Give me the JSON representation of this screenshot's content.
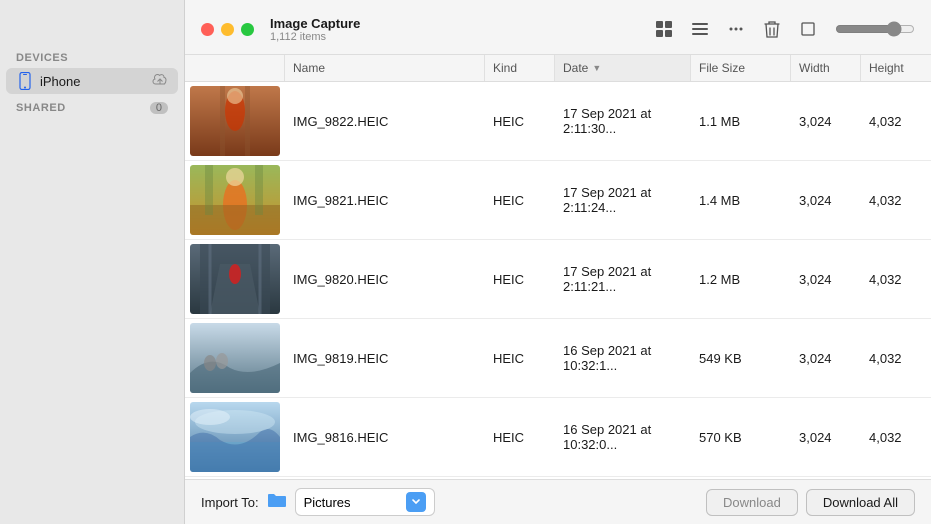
{
  "app": {
    "title": "Image Capture",
    "item_count": "1,112 items"
  },
  "window_controls": {
    "close_label": "close",
    "minimize_label": "minimize",
    "maximize_label": "maximize"
  },
  "toolbar": {
    "grid_view_icon": "⊞",
    "list_view_icon": "≡",
    "more_icon": "⋯",
    "delete_icon": "🗑",
    "crop_icon": "⬜",
    "zoom_value": 80
  },
  "sidebar": {
    "devices_label": "DEVICES",
    "iphone_label": "iPhone",
    "shared_label": "SHARED",
    "shared_count": "0"
  },
  "table": {
    "columns": [
      {
        "id": "thumb",
        "label": ""
      },
      {
        "id": "name",
        "label": "Name"
      },
      {
        "id": "kind",
        "label": "Kind"
      },
      {
        "id": "date",
        "label": "Date",
        "sorted": true,
        "sort_dir": "desc"
      },
      {
        "id": "size",
        "label": "File Size"
      },
      {
        "id": "width",
        "label": "Width"
      },
      {
        "id": "height",
        "label": "Height"
      }
    ],
    "rows": [
      {
        "id": 1,
        "thumb_color_top": "#c45c2a",
        "thumb_color_bottom": "#8b4513",
        "name": "IMG_9822.HEIC",
        "kind": "HEIC",
        "date": "17 Sep 2021  at 2:11:30...",
        "size": "1.1 MB",
        "width": "3,024",
        "height": "4,032"
      },
      {
        "id": 2,
        "thumb_color_top": "#d4a044",
        "thumb_color_bottom": "#a0522d",
        "name": "IMG_9821.HEIC",
        "kind": "HEIC",
        "date": "17 Sep 2021  at 2:11:24...",
        "size": "1.4 MB",
        "width": "3,024",
        "height": "4,032"
      },
      {
        "id": 3,
        "thumb_color_top": "#6b7c8a",
        "thumb_color_bottom": "#3a4a55",
        "name": "IMG_9820.HEIC",
        "kind": "HEIC",
        "date": "17 Sep 2021  at 2:11:21...",
        "size": "1.2 MB",
        "width": "3,024",
        "height": "4,032"
      },
      {
        "id": 4,
        "thumb_color_top": "#87a0b8",
        "thumb_color_bottom": "#4a6070",
        "name": "IMG_9819.HEIC",
        "kind": "HEIC",
        "date": "16 Sep 2021  at 10:32:1...",
        "size": "549 KB",
        "width": "3,024",
        "height": "4,032"
      },
      {
        "id": 5,
        "thumb_color_top": "#b8d0e8",
        "thumb_color_bottom": "#6088a8",
        "name": "IMG_9816.HEIC",
        "kind": "HEIC",
        "date": "16 Sep 2021  at 10:32:0...",
        "size": "570 KB",
        "width": "3,024",
        "height": "4,032"
      }
    ]
  },
  "footer": {
    "import_label": "Import To:",
    "folder_name": "Pictures",
    "download_label": "Download",
    "download_all_label": "Download All"
  },
  "thumb_scenes": [
    {
      "desc": "woman in red sari, arched doorway, warm tones",
      "bg": "#b85c2c",
      "accent": "#e0884a"
    },
    {
      "desc": "woman in yellow/orange sari, green garden, temple",
      "bg": "#c89040",
      "accent": "#f0c060"
    },
    {
      "desc": "dark stairwell, person in red, stone architecture",
      "bg": "#4a5c6a",
      "accent": "#cc2222"
    },
    {
      "desc": "cyclists on mountain road, hazy sky",
      "bg": "#7090a8",
      "accent": "#c8c8c8"
    },
    {
      "desc": "misty mountain landscape, foggy valley",
      "bg": "#90b8d0",
      "accent": "#d8e8f0"
    }
  ]
}
